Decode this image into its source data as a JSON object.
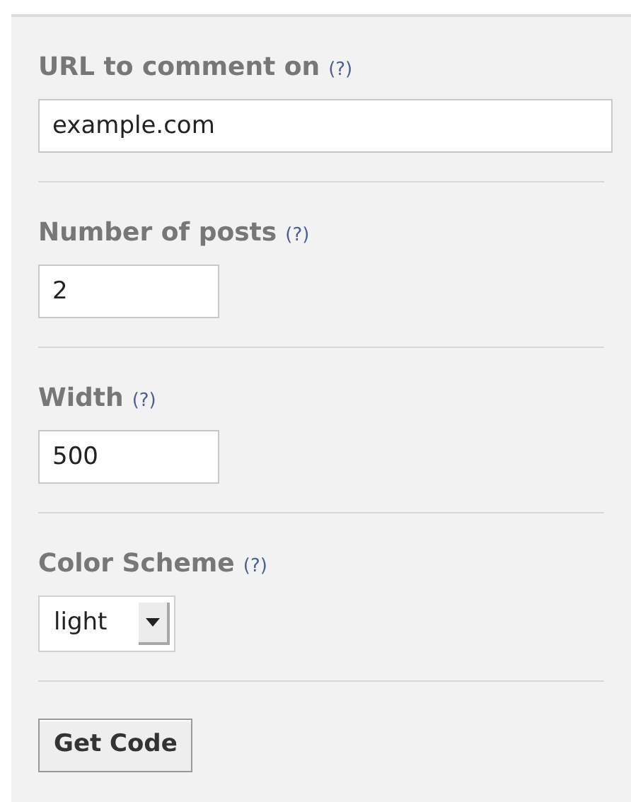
{
  "fields": [
    {
      "label": "URL to comment on",
      "help": "(?)",
      "kind": "wide",
      "value": "example.com"
    },
    {
      "label": "Number of posts",
      "help": "(?)",
      "kind": "text",
      "value": "2"
    },
    {
      "label": "Width",
      "help": "(?)",
      "kind": "text",
      "value": "500"
    },
    {
      "label": "Color Scheme",
      "help": "(?)",
      "kind": "select",
      "value": "light"
    }
  ],
  "button": "Get Code"
}
